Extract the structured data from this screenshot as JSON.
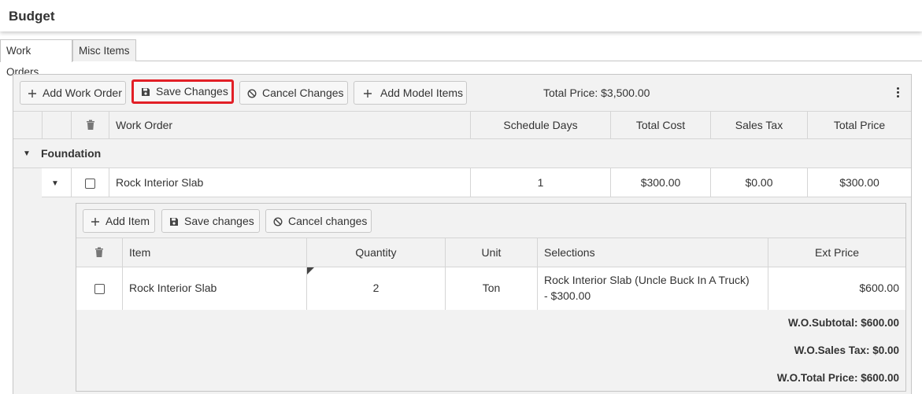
{
  "page": {
    "title": "Budget"
  },
  "tabs": [
    {
      "label": "Work Orders",
      "active": true
    },
    {
      "label": "Misc Items",
      "active": false
    }
  ],
  "toolbar": {
    "add_work_order": "Add Work Order",
    "save_changes": "Save Changes",
    "cancel_changes": "Cancel Changes",
    "add_model_items": "Add Model Items",
    "total_price": "Total Price: $3,500.00"
  },
  "columns": {
    "work_order": "Work Order",
    "schedule_days": "Schedule Days",
    "total_cost": "Total Cost",
    "sales_tax": "Sales Tax",
    "total_price": "Total Price"
  },
  "group": {
    "label": "Foundation"
  },
  "work_order_row": {
    "name": "Rock Interior Slab",
    "schedule_days": "1",
    "total_cost": "$300.00",
    "sales_tax": "$0.00",
    "total_price": "$300.00"
  },
  "detail": {
    "toolbar": {
      "add_item": "Add Item",
      "save_changes": "Save changes",
      "cancel_changes": "Cancel changes"
    },
    "columns": {
      "item": "Item",
      "quantity": "Quantity",
      "unit": "Unit",
      "selections": "Selections",
      "ext_price": "Ext Price"
    },
    "rows": [
      {
        "item": "Rock Interior Slab",
        "quantity": "2",
        "unit": "Ton",
        "selections": "Rock Interior Slab (Uncle Buck In A Truck) - $300.00",
        "ext_price": "$600.00"
      }
    ],
    "summary": {
      "subtotal": "W.O.Subtotal: $600.00",
      "sales_tax": "W.O.Sales Tax: $0.00",
      "total_price": "W.O.Total Price: $600.00"
    }
  },
  "colors": {
    "highlight": "#e21f26",
    "toolbar_bg": "#f2f2f2",
    "border": "#c5c5c5"
  },
  "icons": {
    "add": "plus-icon",
    "save": "floppy-disk-icon",
    "cancel": "cancel-circle-icon",
    "delete": "trash-icon",
    "menu": "kebab-menu-icon",
    "expand": "triangle-down-icon"
  }
}
